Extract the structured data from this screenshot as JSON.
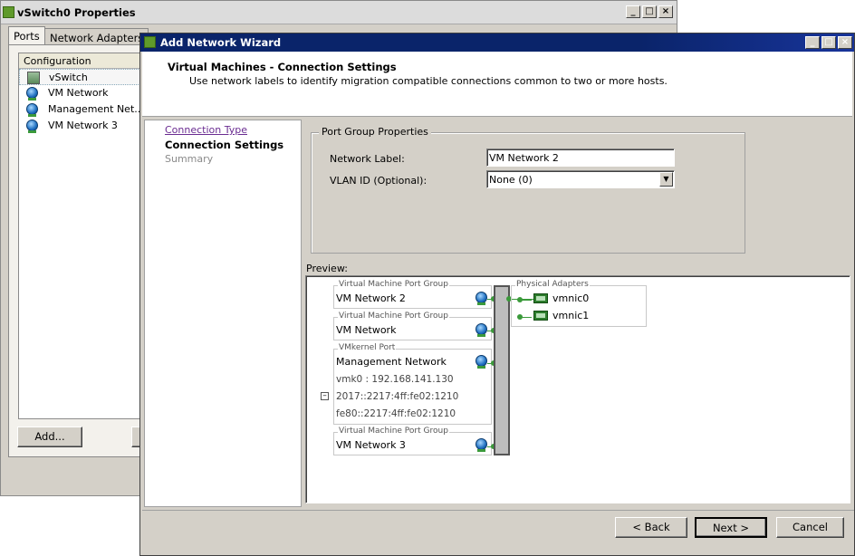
{
  "back_window": {
    "title": "vSwitch0 Properties",
    "tabs": [
      "Ports",
      "Network Adapters"
    ],
    "list_header": "Configuration",
    "items": [
      {
        "label": "vSwitch",
        "icon": "switch-icon"
      },
      {
        "label": "VM Network",
        "icon": "network-icon"
      },
      {
        "label": "Management Net...",
        "icon": "network-icon"
      },
      {
        "label": "VM Network 3",
        "icon": "network-icon"
      }
    ],
    "add_button": "Add..."
  },
  "wizard": {
    "title": "Add Network Wizard",
    "header_title": "Virtual Machines - Connection Settings",
    "header_subtitle": "Use network labels to identify migration compatible connections common to two or more hosts.",
    "steps": {
      "connection_type": "Connection Type",
      "connection_settings": "Connection Settings",
      "summary": "Summary"
    },
    "port_group": {
      "legend": "Port Group Properties",
      "network_label_label": "Network Label:",
      "network_label_value": "VM Network 2",
      "vlan_label": "VLAN ID (Optional):",
      "vlan_value": "None (0)"
    },
    "preview_label": "Preview:",
    "preview": {
      "groups": [
        {
          "caption": "Virtual Machine Port Group",
          "name": "VM Network 2"
        },
        {
          "caption": "Virtual Machine Port Group",
          "name": "VM Network"
        },
        {
          "caption": "VMkernel Port",
          "name": "Management Network",
          "lines": [
            "vmk0 : 192.168.141.130",
            "2017::2217:4ff:fe02:1210",
            "fe80::2217:4ff:fe02:1210"
          ]
        },
        {
          "caption": "Virtual Machine Port Group",
          "name": "VM Network 3"
        }
      ],
      "physical_adapters_caption": "Physical Adapters",
      "adapters": [
        "vmnic0",
        "vmnic1"
      ]
    },
    "buttons": {
      "back": "< Back",
      "next": "Next >",
      "cancel": "Cancel"
    }
  }
}
